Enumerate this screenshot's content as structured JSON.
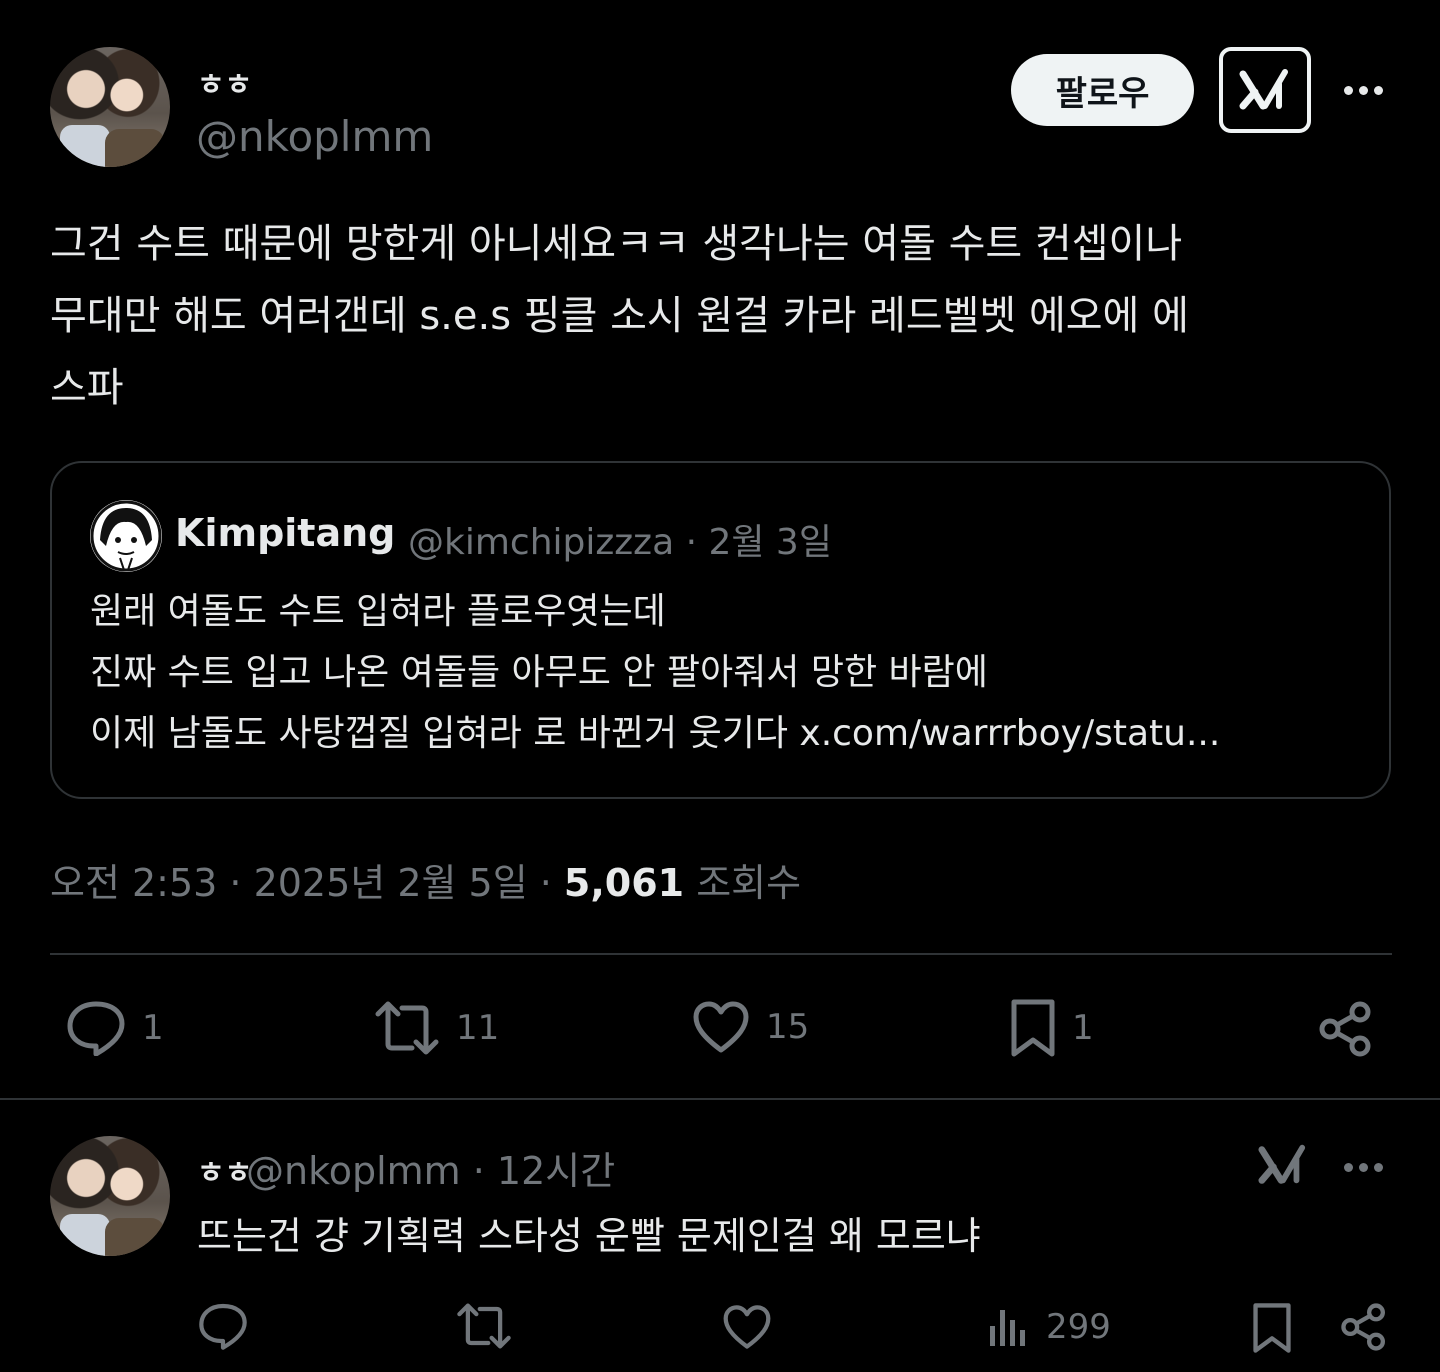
{
  "main_tweet": {
    "display_name": "ㅎㅎ",
    "handle": "@nkoplmm",
    "follow_label": "팔로우",
    "text": "그건 수트 때문에 망한게 아니세요ㅋㅋ 생각나는 여돌 수트 컨셉이나\n무대만 해도 여러갠데 s.e.s 핑클 소시 원걸 카라 레드벨벳 에오에 에\n스파",
    "quote": {
      "name": "Kimpitang",
      "meta": "@kimchipizzza · 2월 3일",
      "lines": [
        "원래 여돌도 수트 입혀라 플로우엿는데",
        "진짜 수트 입고 나온 여돌들 아무도 안 팔아줘서 망한 바람에",
        "이제 남돌도 사탕껍질 입혀라 로 바뀐거 웃기다 x.com/warrrboy/statu..."
      ]
    },
    "time": "오전 2:53 · 2025년 2월 5일 · ",
    "views_count": "5,061",
    "views_label": " 조회수",
    "stats": {
      "replies": "1",
      "retweets": "11",
      "likes": "15",
      "bookmarks": "1"
    }
  },
  "reply": {
    "display_name": "ㅎㅎ",
    "meta": "@nkoplmm · 12시간",
    "text": "뜨는건 걍 기획력 스타성 운빨 문제인걸 왜 모르냐",
    "views": "299"
  }
}
